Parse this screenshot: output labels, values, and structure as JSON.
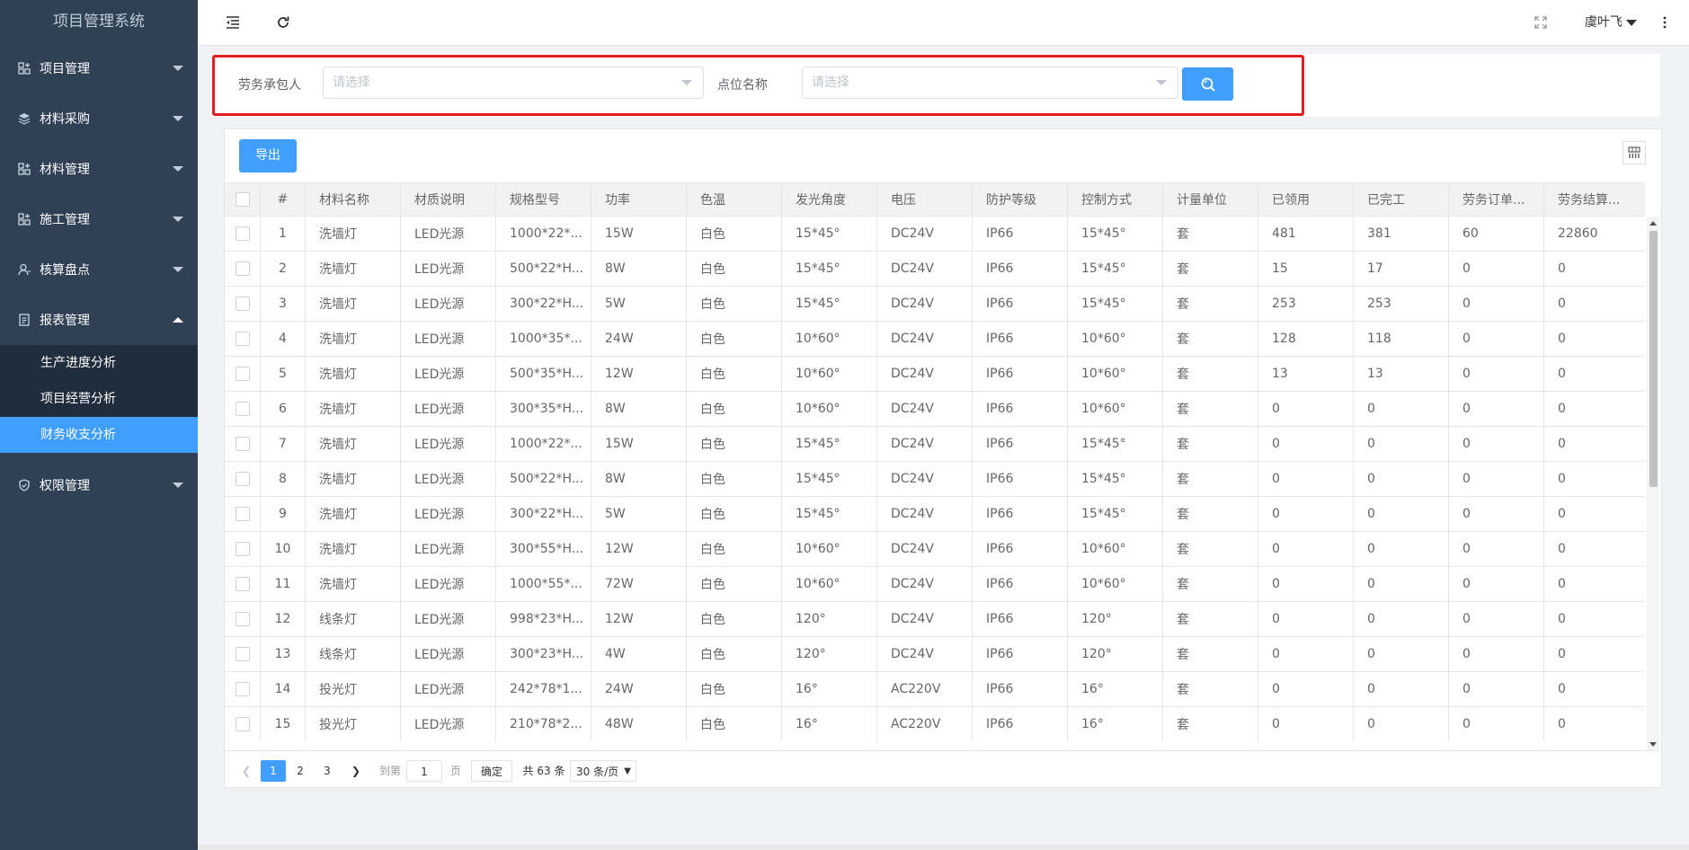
{
  "app": {
    "title": "项目管理系统"
  },
  "sidebar": {
    "items": [
      {
        "label": "项目管理",
        "icon": "project-icon"
      },
      {
        "label": "材料采购",
        "icon": "layers-icon"
      },
      {
        "label": "材料管理",
        "icon": "grid-plus-icon"
      },
      {
        "label": "施工管理",
        "icon": "grid-plus-icon"
      },
      {
        "label": "核算盘点",
        "icon": "user-icon"
      },
      {
        "label": "报表管理",
        "icon": "report-icon",
        "expanded": true,
        "children": [
          {
            "label": "生产进度分析"
          },
          {
            "label": "项目经营分析"
          },
          {
            "label": "财务收支分析",
            "active": true
          }
        ]
      },
      {
        "label": "权限管理",
        "icon": "shield-icon"
      }
    ]
  },
  "header": {
    "user_name": "虞叶飞"
  },
  "search": {
    "contractor_label": "劳务承包人",
    "contractor_placeholder": "请选择",
    "point_label": "点位名称",
    "point_placeholder": "请选择"
  },
  "toolbar": {
    "export_label": "导出"
  },
  "table": {
    "headers": [
      "#",
      "材料名称",
      "材质说明",
      "规格型号",
      "功率",
      "色温",
      "发光角度",
      "电压",
      "防护等级",
      "控制方式",
      "计量单位",
      "已领用",
      "已完工",
      "劳务订单...",
      "劳务结算..."
    ],
    "rows": [
      [
        "1",
        "洗墙灯",
        "LED光源",
        "1000*22*...",
        "15W",
        "白色",
        "15*45°",
        "DC24V",
        "IP66",
        "15*45°",
        "套",
        "481",
        "381",
        "60",
        "22860"
      ],
      [
        "2",
        "洗墙灯",
        "LED光源",
        "500*22*H...",
        "8W",
        "白色",
        "15*45°",
        "DC24V",
        "IP66",
        "15*45°",
        "套",
        "15",
        "17",
        "0",
        "0"
      ],
      [
        "3",
        "洗墙灯",
        "LED光源",
        "300*22*H...",
        "5W",
        "白色",
        "15*45°",
        "DC24V",
        "IP66",
        "15*45°",
        "套",
        "253",
        "253",
        "0",
        "0"
      ],
      [
        "4",
        "洗墙灯",
        "LED光源",
        "1000*35*...",
        "24W",
        "白色",
        "10*60°",
        "DC24V",
        "IP66",
        "10*60°",
        "套",
        "128",
        "118",
        "0",
        "0"
      ],
      [
        "5",
        "洗墙灯",
        "LED光源",
        "500*35*H...",
        "12W",
        "白色",
        "10*60°",
        "DC24V",
        "IP66",
        "10*60°",
        "套",
        "13",
        "13",
        "0",
        "0"
      ],
      [
        "6",
        "洗墙灯",
        "LED光源",
        "300*35*H...",
        "8W",
        "白色",
        "10*60°",
        "DC24V",
        "IP66",
        "10*60°",
        "套",
        "0",
        "0",
        "0",
        "0"
      ],
      [
        "7",
        "洗墙灯",
        "LED光源",
        "1000*22*...",
        "15W",
        "白色",
        "15*45°",
        "DC24V",
        "IP66",
        "15*45°",
        "套",
        "0",
        "0",
        "0",
        "0"
      ],
      [
        "8",
        "洗墙灯",
        "LED光源",
        "500*22*H...",
        "8W",
        "白色",
        "15*45°",
        "DC24V",
        "IP66",
        "15*45°",
        "套",
        "0",
        "0",
        "0",
        "0"
      ],
      [
        "9",
        "洗墙灯",
        "LED光源",
        "300*22*H...",
        "5W",
        "白色",
        "15*45°",
        "DC24V",
        "IP66",
        "15*45°",
        "套",
        "0",
        "0",
        "0",
        "0"
      ],
      [
        "10",
        "洗墙灯",
        "LED光源",
        "300*55*H...",
        "12W",
        "白色",
        "10*60°",
        "DC24V",
        "IP66",
        "10*60°",
        "套",
        "0",
        "0",
        "0",
        "0"
      ],
      [
        "11",
        "洗墙灯",
        "LED光源",
        "1000*55*...",
        "72W",
        "白色",
        "10*60°",
        "DC24V",
        "IP66",
        "10*60°",
        "套",
        "0",
        "0",
        "0",
        "0"
      ],
      [
        "12",
        "线条灯",
        "LED光源",
        "998*23*H...",
        "12W",
        "白色",
        "120°",
        "DC24V",
        "IP66",
        "120°",
        "套",
        "0",
        "0",
        "0",
        "0"
      ],
      [
        "13",
        "线条灯",
        "LED光源",
        "300*23*H...",
        "4W",
        "白色",
        "120°",
        "DC24V",
        "IP66",
        "120°",
        "套",
        "0",
        "0",
        "0",
        "0"
      ],
      [
        "14",
        "投光灯",
        "LED光源",
        "242*78*1...",
        "24W",
        "白色",
        "16°",
        "AC220V",
        "IP66",
        "16°",
        "套",
        "0",
        "0",
        "0",
        "0"
      ],
      [
        "15",
        "投光灯",
        "LED光源",
        "210*78*2...",
        "48W",
        "白色",
        "16°",
        "AC220V",
        "IP66",
        "16°",
        "套",
        "0",
        "0",
        "0",
        "0"
      ]
    ]
  },
  "pagination": {
    "pages": [
      "1",
      "2",
      "3"
    ],
    "current": "1",
    "goto_label": "到第",
    "goto_value": "1",
    "page_unit": "页",
    "confirm_label": "确定",
    "total_label": "共 63 条",
    "page_size": "30 条/页"
  },
  "colors": {
    "sidebar_bg": "#304156",
    "submenu_bg": "#1f2d3d",
    "accent": "#409eff",
    "highlight": "#e02020"
  }
}
